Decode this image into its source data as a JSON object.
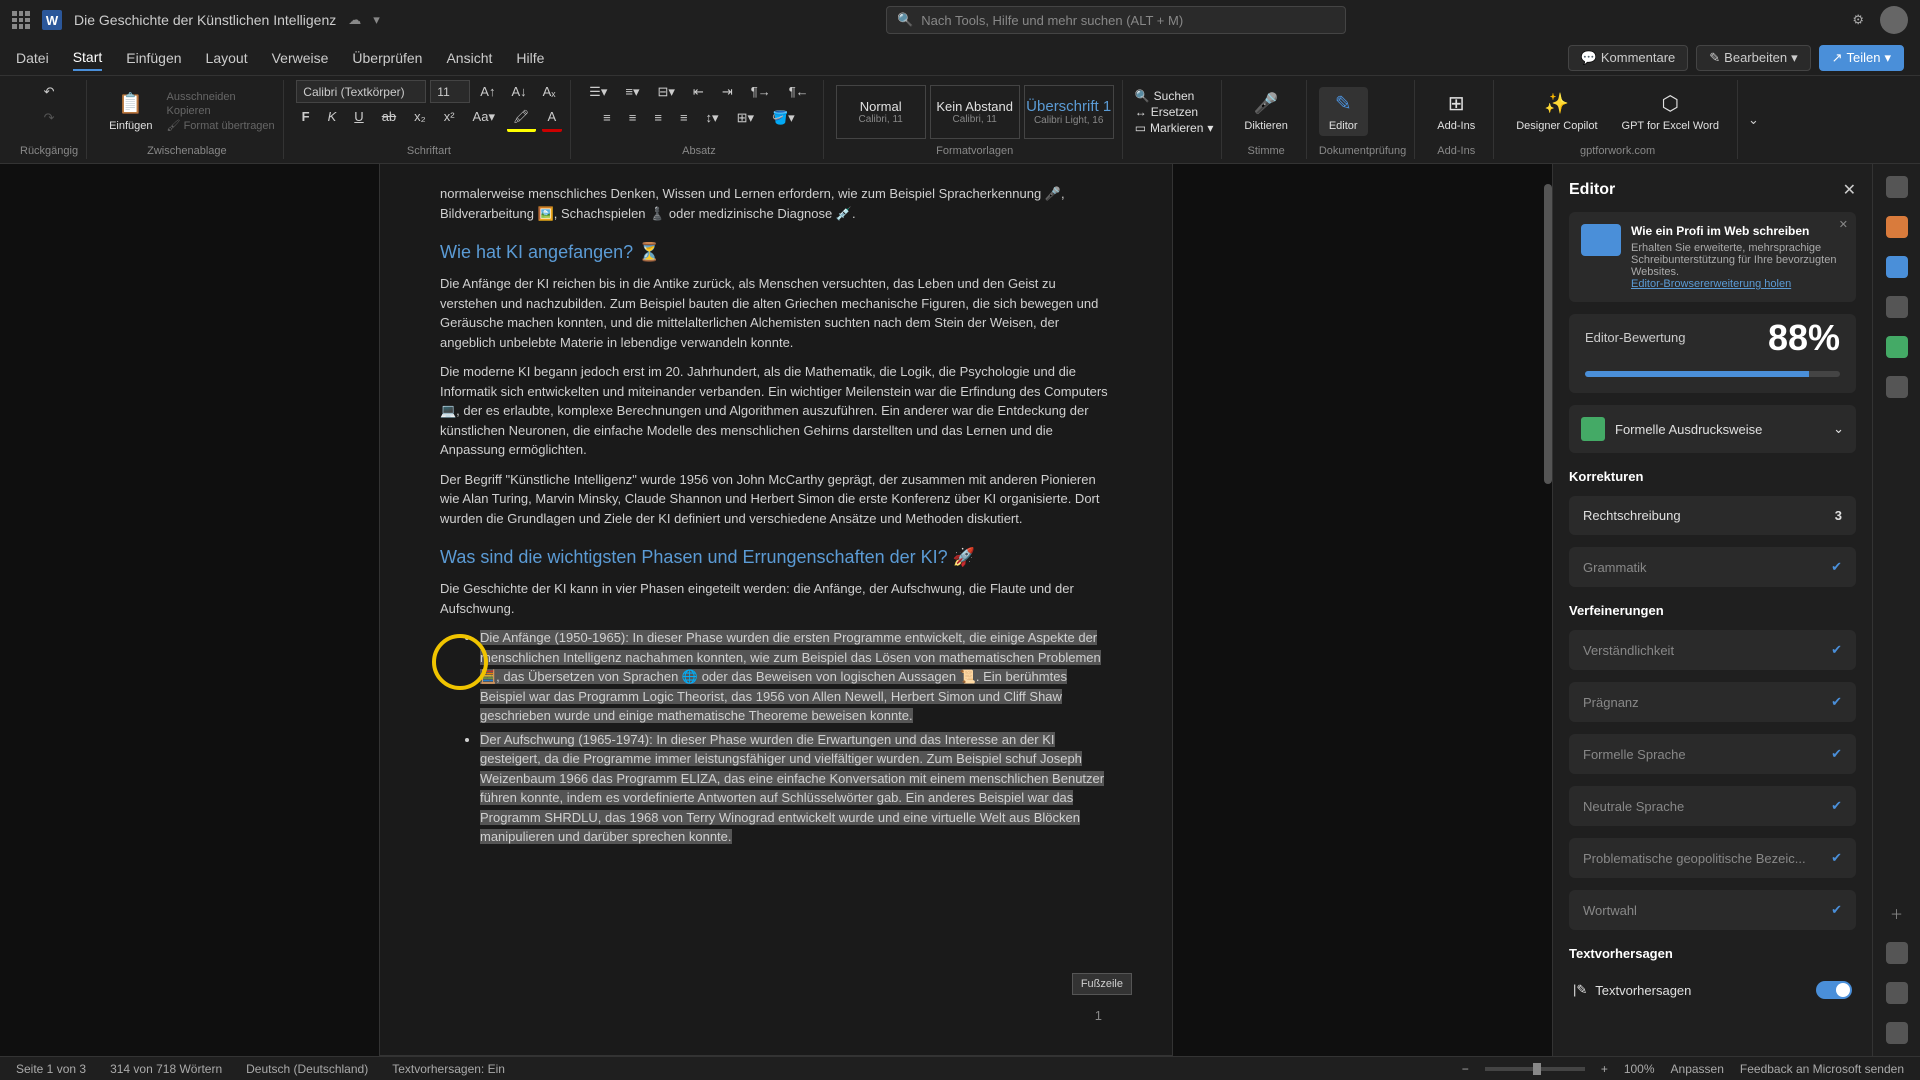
{
  "title_bar": {
    "doc_title": "Die Geschichte der Künstlichen Intelligenz",
    "search_placeholder": "Nach Tools, Hilfe und mehr suchen (ALT + M)"
  },
  "tabs": {
    "items": [
      "Datei",
      "Start",
      "Einfügen",
      "Layout",
      "Verweise",
      "Überprüfen",
      "Ansicht",
      "Hilfe"
    ],
    "active_index": 1,
    "comments": "Kommentare",
    "edit": "Bearbeiten",
    "share": "Teilen"
  },
  "ribbon": {
    "undo_group": "Rückgängig",
    "clipboard": {
      "paste": "Einfügen",
      "cut": "Ausschneiden",
      "copy": "Kopieren",
      "format_painter": "Format übertragen",
      "label": "Zwischenablage"
    },
    "font": {
      "family": "Calibri (Textkörper)",
      "size": "11",
      "label": "Schriftart"
    },
    "paragraph": {
      "label": "Absatz"
    },
    "styles": {
      "normal": {
        "name": "Normal",
        "sub": "Calibri, 11"
      },
      "nospace": {
        "name": "Kein Abstand",
        "sub": "Calibri, 11"
      },
      "heading1": {
        "name": "Überschrift 1",
        "sub": "Calibri Light, 16"
      },
      "label": "Formatvorlagen"
    },
    "editing": {
      "find": "Suchen",
      "replace": "Ersetzen",
      "select": "Markieren"
    },
    "dictate": {
      "label": "Diktieren",
      "group": "Stimme"
    },
    "editor_btn": {
      "label": "Editor",
      "group": "Dokumentprüfung"
    },
    "addins": {
      "label": "Add-Ins",
      "group": "Add-Ins"
    },
    "copilot": {
      "label": "Designer Copilot"
    },
    "gpt": {
      "label": "GPT for Excel Word",
      "group": "gptforwork.com"
    }
  },
  "document": {
    "para0": "normalerweise menschliches Denken, Wissen und Lernen erfordern, wie zum Beispiel Spracherkennung 🎤, Bildverarbeitung 🖼️, Schachspielen ♟️ oder medizinische Diagnose 💉.",
    "h1": "Wie hat KI angefangen? ⏳",
    "para1": "Die Anfänge der KI reichen bis in die Antike zurück, als Menschen versuchten, das Leben und den Geist zu verstehen und nachzubilden. Zum Beispiel bauten die alten Griechen mechanische Figuren, die sich bewegen und Geräusche machen konnten, und die mittelalterlichen Alchemisten suchten nach dem Stein der Weisen, der angeblich unbelebte Materie in lebendige verwandeln konnte.",
    "para2": "Die moderne KI begann jedoch erst im 20. Jahrhundert, als die Mathematik, die Logik, die Psychologie und die Informatik sich entwickelten und miteinander verbanden. Ein wichtiger Meilenstein war die Erfindung des Computers 💻, der es erlaubte, komplexe Berechnungen und Algorithmen auszuführen. Ein anderer war die Entdeckung der künstlichen Neuronen, die einfache Modelle des menschlichen Gehirns darstellten und das Lernen und die Anpassung ermöglichten.",
    "para3": "Der Begriff \"Künstliche Intelligenz\" wurde 1956 von John McCarthy geprägt, der zusammen mit anderen Pionieren wie Alan Turing, Marvin Minsky, Claude Shannon und Herbert Simon die erste Konferenz über KI organisierte. Dort wurden die Grundlagen und Ziele der KI definiert und verschiedene Ansätze und Methoden diskutiert.",
    "h2": "Was sind die wichtigsten Phasen und Errungenschaften der KI? 🚀",
    "para4": "Die Geschichte der KI kann in vier Phasen eingeteilt werden: die Anfänge, der Aufschwung, die Flaute und der Aufschwung.",
    "li1": "Die Anfänge (1950-1965): In dieser Phase wurden die ersten Programme entwickelt, die einige Aspekte der menschlichen Intelligenz nachahmen konnten, wie zum Beispiel das Lösen von mathematischen Problemen 🧮, das Übersetzen von Sprachen 🌐 oder das Beweisen von logischen Aussagen 📜. Ein berühmtes Beispiel war das Programm Logic Theorist, das 1956 von Allen Newell, Herbert Simon und Cliff Shaw geschrieben wurde und einige mathematische Theoreme beweisen konnte.",
    "li2": "Der Aufschwung (1965-1974): In dieser Phase wurden die Erwartungen und das Interesse an der KI gesteigert, da die Programme immer leistungsfähiger und vielfältiger wurden. Zum Beispiel schuf Joseph Weizenbaum 1966 das Programm ELIZA, das eine einfache Konversation mit einem menschlichen Benutzer führen konnte, indem es vordefinierte Antworten auf Schlüsselwörter gab. Ein anderes Beispiel war das Programm SHRDLU, das 1968 von Terry Winograd entwickelt wurde und eine virtuelle Welt aus Blöcken manipulieren und darüber sprechen konnte.",
    "footer": "Fußzeile",
    "page_num": "1"
  },
  "editor": {
    "title": "Editor",
    "promo": {
      "heading": "Wie ein Profi im Web schreiben",
      "text": "Erhalten Sie erweiterte, mehrsprachige Schreibunterstützung für Ihre bevorzugten Websites.",
      "link": "Editor-Browsererweiterung holen"
    },
    "score": {
      "label": "Editor-Bewertung",
      "value": "88%"
    },
    "style": "Formelle Ausdrucksweise",
    "corrections_label": "Korrekturen",
    "spelling": {
      "label": "Rechtschreibung",
      "count": "3"
    },
    "grammar": "Grammatik",
    "refinements_label": "Verfeinerungen",
    "refinements": [
      "Verständlichkeit",
      "Prägnanz",
      "Formelle Sprache",
      "Neutrale Sprache",
      "Problematische geopolitische Bezeic...",
      "Wortwahl"
    ],
    "predictions_label": "Textvorhersagen",
    "predictions_toggle": "Textvorhersagen"
  },
  "status": {
    "page": "Seite 1 von 3",
    "words": "314 von 718 Wörtern",
    "lang": "Deutsch (Deutschland)",
    "predictions": "Textvorhersagen: Ein",
    "zoom": "100%",
    "fit": "Anpassen",
    "feedback": "Feedback an Microsoft senden"
  }
}
